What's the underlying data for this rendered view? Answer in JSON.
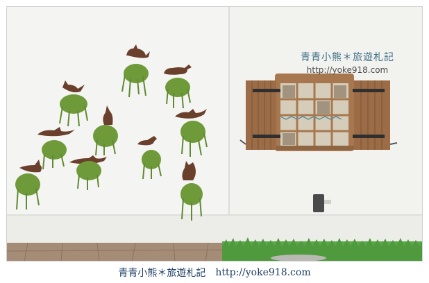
{
  "watermark": {
    "title": "青青小熊＊旅遊札記",
    "url": "http://yoke918.com"
  },
  "footer": {
    "title": "青青小熊＊旅遊札記",
    "url": "http://yoke918.com"
  },
  "colors": {
    "wall": "#f3f3f0",
    "cat": "#6a3f2c",
    "plant": "#6f9a3a",
    "shutter": "#9a6a43",
    "deck": "#a88f79",
    "grass": "#58a646"
  }
}
